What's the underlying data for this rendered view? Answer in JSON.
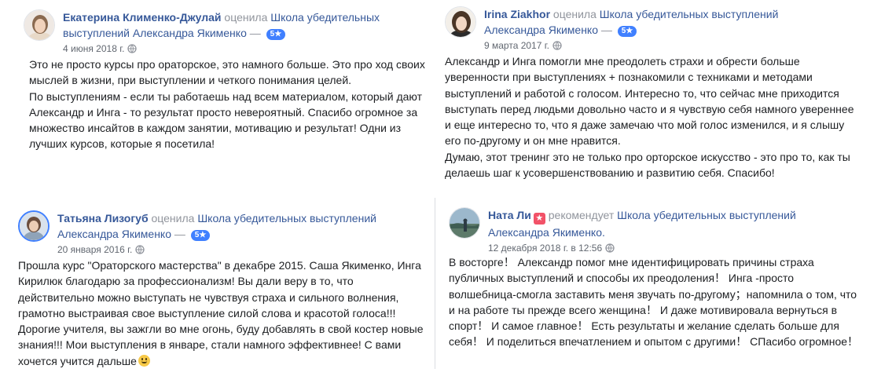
{
  "reviews": [
    {
      "author": "Екатерина Клименко-Джулай",
      "verb": "оценила",
      "page_line1": "Школа убедительных",
      "page_line2": "выступлений Александра Якименко",
      "rating": "5★",
      "date": "4 июня 2018 г.",
      "text": "Это не просто курсы про ораторское, это намного больше. Это про ход своих\nмыслей в жизни, при выступлении и четкого понимания целей.\nПо выступлениям - если ты работаешь над всем материалом, который дают\nАлександр и Инга - то результат просто невероятный. Спасибо огромное за\nмножество инсайтов в каждом занятии, мотивацию и результат! Одни из\nлучших курсов, которые я посетила!"
    },
    {
      "author": "Irina Ziakhor",
      "verb": "оценила",
      "page_line1": "Школа убедительных выступлений",
      "page_line2": "Александра Якименко",
      "rating": "5★",
      "date": "9 марта 2017 г.",
      "text": "Александр и Инга помогли мне преодолеть страхи и обрести больше\nуверенности при выступлениях + познакомили с техниками и методами\nвыступлений и работой с голосом. Интересно то, что сейчас мне приходится\nвыступать перед людьми довольно часто и я чувствую себя намного увереннее\nи еще интересно то, что я даже замечаю что мой голос изменился, и я слышу\nего по-другому и он мне нравится.\nДумаю, этот тренинг это не только про орторское искусство - это про то, как ты\nделаешь шаг к усовершенствованию и развитию себя. Спасибо!"
    },
    {
      "author": "Татьяна Лизогуб",
      "verb": "оценила",
      "page_line1": "Школа убедительных выступлений",
      "page_line2": "Александра Якименко",
      "rating": "5★",
      "date": "20 января 2016 г.",
      "text": "Прошла курс \"Ораторского мастерства\" в декабре 2015. Саша Якименко, Инга\nКирилюк благодарю за профессионализм! Вы дали веру в то, что\nдействительно можно выступать не чувствуя страха и сильного волнения,\nграмотно выстраивая свое выступление силой слова и красотой голоса!!!\nДорогие учителя, вы зажгли во мне огонь, буду добавлять в свой костер новые\nзнания!!! Мои выступления в январе, стали намного эффективнее! С вами\nхочется учится дальше"
    },
    {
      "author": "Ната Ли",
      "verb": "рекомендует",
      "page_line1": "Школа убедительных выступлений",
      "page_line2": "Александра Якименко.",
      "date": "12 декабря 2018 г. в 12:56",
      "text": "В восторге！ Александр помог мне идентифицировать причины страха\nпубличных выступлений и способы их преодоления！ Инга -просто\nволшебница-смогла заставить меня звучать по-другому；напомнила о том, что\nи на работе ты прежде всего женщина！ И даже мотивировала вернуться в\nспорт！ И самое главное！ Есть результаты и желание сделать больше для\nсебя！ И поделиться впечатлением и опытом с другими！ СПасибо огромное！"
    }
  ],
  "icons": {
    "privacy": "globe-icon",
    "top_fan": "star-badge",
    "emoji": "smiling-face-emoji"
  },
  "colors": {
    "link": "#365899",
    "rating_badge": "#4080ff",
    "meta_text": "#616770"
  }
}
